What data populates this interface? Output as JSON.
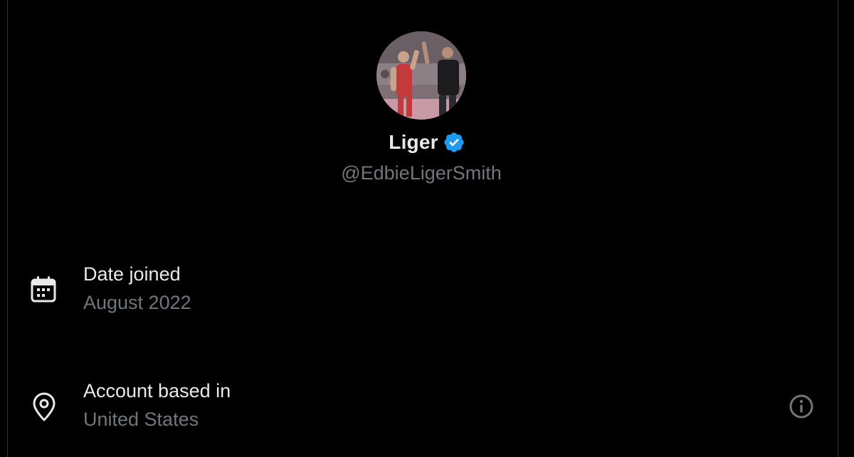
{
  "profile": {
    "display_name": "Liger",
    "handle": "@EdbieLigerSmith",
    "verified": true,
    "verified_color": "#1d9bf0"
  },
  "avatar": {
    "icon": "profile-photo",
    "description_colors": {
      "singlet": "#c43a3a",
      "background": "#8a7a7e"
    }
  },
  "details": {
    "date_joined": {
      "icon": "calendar-icon",
      "label": "Date joined",
      "value": "August 2022"
    },
    "account_location": {
      "icon": "location-pin-icon",
      "label": "Account based in",
      "value": "United States",
      "info_icon": "info-icon"
    }
  },
  "theme": {
    "background": "#000000",
    "primary_text": "#e7e9ea",
    "secondary_text": "#71767b"
  }
}
